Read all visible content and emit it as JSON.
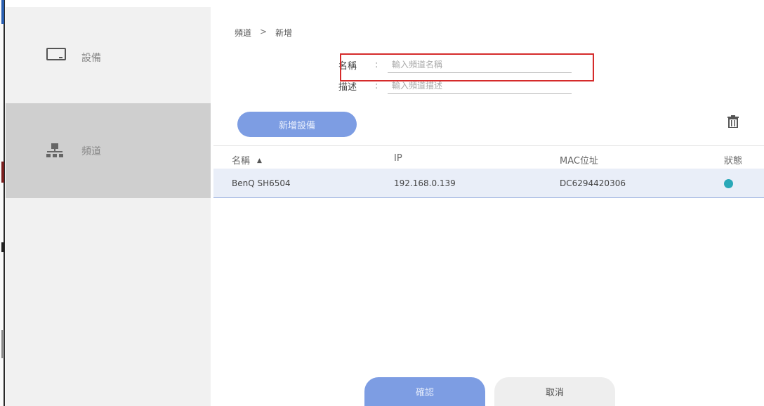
{
  "sidebar": {
    "items": [
      {
        "label": "設備",
        "icon": "monitor-icon",
        "selected": false
      },
      {
        "label": "頻道",
        "icon": "network-icon",
        "selected": true
      }
    ]
  },
  "breadcrumb": {
    "parent": "頻道",
    "separator": ">",
    "current": "新增"
  },
  "form": {
    "name": {
      "label": "名稱",
      "colon": ":",
      "placeholder": "輸入頻道名稱",
      "value": ""
    },
    "description": {
      "label": "描述",
      "colon": ":",
      "placeholder": "輸入頻道描述",
      "value": ""
    }
  },
  "toolbar": {
    "add_device_label": "新增設備",
    "delete_icon": "trash-icon"
  },
  "table": {
    "columns": [
      "名稱",
      "IP",
      "MAC位址",
      "狀態"
    ],
    "sort_indicator": "▲",
    "rows": [
      {
        "name": "BenQ SH6504",
        "ip": "192.168.0.139",
        "mac": "DC6294420306",
        "status": "online"
      }
    ]
  },
  "footer": {
    "confirm_label": "確認",
    "cancel_label": "取消"
  },
  "colors": {
    "accent": "#7d9de3",
    "highlight": "#d52b2b",
    "status_online": "#2aa8b8",
    "sidebar_selected": "#cfcfcf"
  }
}
